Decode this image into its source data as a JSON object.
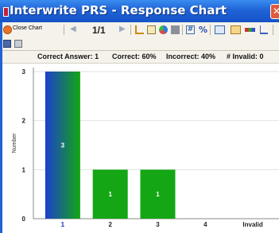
{
  "window": {
    "title": "Interwrite PRS - Response Chart"
  },
  "toolbar": {
    "close_chart_label": "Close Chart",
    "page_indicator": "1/1"
  },
  "stats": {
    "correct_answer": "Correct Answer: 1",
    "correct": "Correct: 60%",
    "incorrect": "Incorrect: 40%",
    "invalid": "# Invalid: 0"
  },
  "colors": {
    "bar_green": "#14a614",
    "bar_correct_top": "#1c3fd0",
    "bar_correct_bottom": "#14a614",
    "correct_tick": "#1c2fb0"
  },
  "chart_data": {
    "type": "bar",
    "categories": [
      "1",
      "2",
      "3",
      "4",
      "Invalid"
    ],
    "values": [
      3,
      1,
      1,
      0,
      0
    ],
    "value_labels": [
      "3",
      "1",
      "1",
      "",
      ""
    ],
    "ylabel": "Number",
    "ylim": [
      0,
      3
    ],
    "yticks": [
      "0",
      "1",
      "2",
      "3"
    ],
    "grid": true,
    "highlight_category": "1"
  }
}
